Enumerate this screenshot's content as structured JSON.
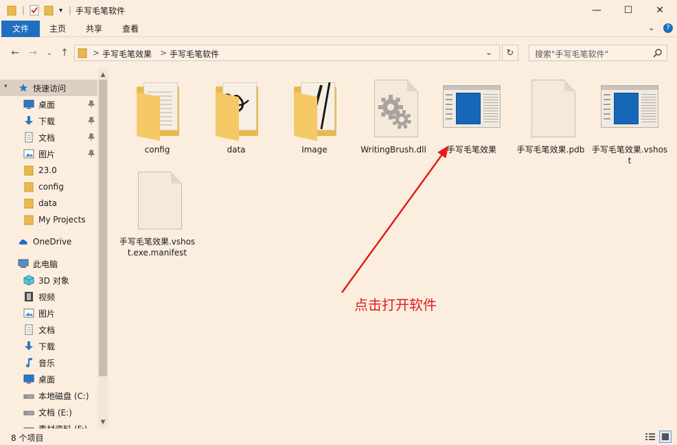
{
  "window": {
    "title": "手写毛笔软件",
    "minimize_glyph": "—",
    "maximize_glyph": "☐",
    "close_glyph": "✕"
  },
  "ribbon": {
    "tabs": [
      {
        "label": "文件",
        "active": true
      },
      {
        "label": "主页",
        "active": false
      },
      {
        "label": "共享",
        "active": false
      },
      {
        "label": "查看",
        "active": false
      }
    ],
    "collapse_glyph": "⌄",
    "help_glyph": "?"
  },
  "navigation": {
    "back_glyph": "←",
    "forward_glyph": "→",
    "recent_glyph": "⌄",
    "up_glyph": "↑",
    "breadcrumb": [
      "手写毛笔效果",
      "手写毛笔软件"
    ],
    "separator": ">",
    "dropdown_glyph": "⌄",
    "refresh_glyph": "↻",
    "search_placeholder": "搜索\"手写毛笔软件\""
  },
  "sidebar": {
    "items": [
      {
        "label": "快速访问",
        "icon": "star-icon",
        "pinned": false,
        "selected": true,
        "indent": 0
      },
      {
        "label": "桌面",
        "icon": "desktop-icon",
        "pinned": true,
        "indent": 1
      },
      {
        "label": "下载",
        "icon": "download-icon",
        "pinned": true,
        "indent": 1
      },
      {
        "label": "文档",
        "icon": "document-icon",
        "pinned": true,
        "indent": 1
      },
      {
        "label": "图片",
        "icon": "picture-icon",
        "pinned": true,
        "indent": 1
      },
      {
        "label": "23.0",
        "icon": "folder-icon",
        "pinned": false,
        "indent": 1
      },
      {
        "label": "config",
        "icon": "folder-icon",
        "pinned": false,
        "indent": 1
      },
      {
        "label": "data",
        "icon": "folder-icon",
        "pinned": false,
        "indent": 1
      },
      {
        "label": "My Projects",
        "icon": "folder-icon",
        "pinned": false,
        "indent": 1
      },
      {
        "label": "OneDrive",
        "icon": "cloud-icon",
        "pinned": false,
        "indent": 0
      },
      {
        "label": "此电脑",
        "icon": "computer-icon",
        "pinned": false,
        "indent": 0
      },
      {
        "label": "3D 对象",
        "icon": "cube-icon",
        "pinned": false,
        "indent": 1
      },
      {
        "label": "视频",
        "icon": "video-icon",
        "pinned": false,
        "indent": 1
      },
      {
        "label": "图片",
        "icon": "picture-icon",
        "pinned": false,
        "indent": 1
      },
      {
        "label": "文档",
        "icon": "document-icon",
        "pinned": false,
        "indent": 1
      },
      {
        "label": "下载",
        "icon": "download-icon",
        "pinned": false,
        "indent": 1
      },
      {
        "label": "音乐",
        "icon": "music-icon",
        "pinned": false,
        "indent": 1
      },
      {
        "label": "桌面",
        "icon": "desktop-icon",
        "pinned": false,
        "indent": 1
      },
      {
        "label": "本地磁盘 (C:)",
        "icon": "drive-icon",
        "pinned": false,
        "indent": 1
      },
      {
        "label": "文档 (E:)",
        "icon": "drive-icon",
        "pinned": false,
        "indent": 1
      },
      {
        "label": "素材资料 (F:)",
        "icon": "drive-icon",
        "pinned": false,
        "indent": 1
      }
    ]
  },
  "files": [
    {
      "name": "config",
      "kind": "folder"
    },
    {
      "name": "data",
      "kind": "folder"
    },
    {
      "name": "Image",
      "kind": "folder"
    },
    {
      "name": "WritingBrush.dll",
      "kind": "dll"
    },
    {
      "name": "手写毛笔效果",
      "kind": "app"
    },
    {
      "name": "手写毛笔效果.pdb",
      "kind": "doc"
    },
    {
      "name": "手写毛笔效果.vshost",
      "kind": "app"
    },
    {
      "name": "手写毛笔效果.vshost.exe.manifest",
      "kind": "doc"
    }
  ],
  "annotation": {
    "text": "点击打开软件",
    "color": "#e31b1b"
  },
  "status": {
    "item_count": "8 个项目"
  },
  "colors": {
    "background": "#fbeedf",
    "accent": "#1e6fc0",
    "folder": "#e9b94a"
  }
}
